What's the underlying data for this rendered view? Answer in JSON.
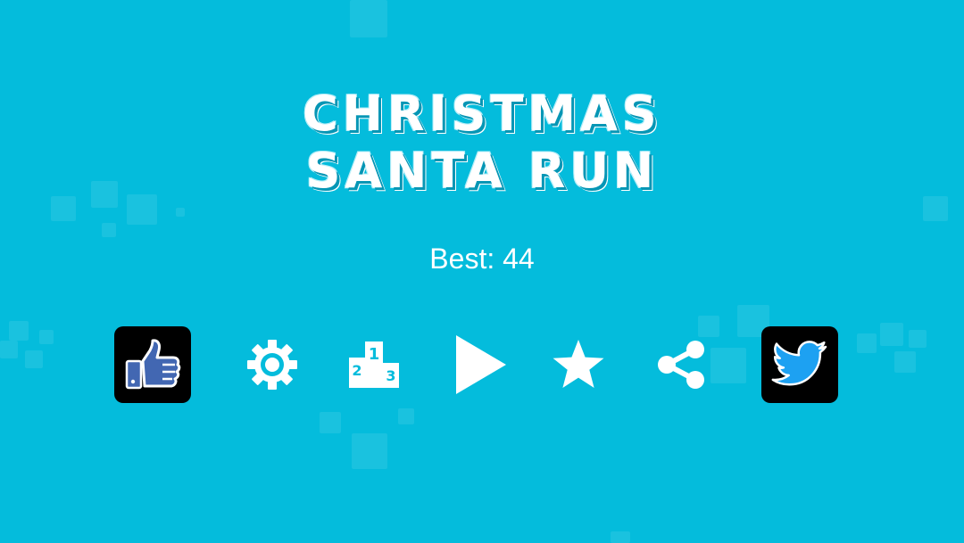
{
  "game": {
    "title_line1": "CHRISTMAS",
    "title_line2": "SANTA RUN",
    "best_label": "Best: 44"
  },
  "menu": {
    "buttons": [
      {
        "name": "facebook-like",
        "icon": "thumbs-up-icon"
      },
      {
        "name": "settings",
        "icon": "gear-icon"
      },
      {
        "name": "leaderboard",
        "icon": "podium-icon",
        "ranks": [
          "1",
          "2",
          "3"
        ]
      },
      {
        "name": "play",
        "icon": "play-icon"
      },
      {
        "name": "rate",
        "icon": "star-icon"
      },
      {
        "name": "share",
        "icon": "share-icon"
      },
      {
        "name": "twitter",
        "icon": "twitter-bird-icon"
      }
    ]
  },
  "colors": {
    "background": "#04bcdc",
    "icon": "#ffffff",
    "social_box": "#000000",
    "facebook_blue": "#4267b2",
    "twitter_blue": "#1da1f2"
  }
}
